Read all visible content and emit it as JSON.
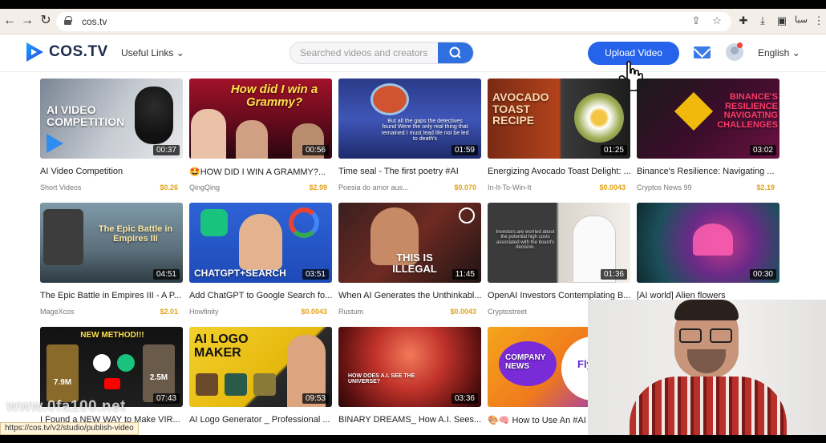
{
  "browser": {
    "url": "cos.tv",
    "extension_label": "ﺳﺒﺎ"
  },
  "header": {
    "logo_text": "COS.TV",
    "useful_links": "Useful Links",
    "search_placeholder": "Searched videos and creators",
    "upload_label": "Upload Video",
    "language": "English"
  },
  "videos": [
    {
      "title": "AI Video Competition",
      "author": "Short Videos",
      "price": "$0.26",
      "duration": "00:37",
      "thumb_text": "AI VIDEO COMPETITION"
    },
    {
      "title": "🤩HOW DID I WIN A GRAMMY?...",
      "author": "QingQing",
      "price": "$2.99",
      "duration": "00:56",
      "thumb_text": "How did I win a Grammy?"
    },
    {
      "title": "Time seal - The first poetry #AI",
      "author": "Poesia do amor aus...",
      "price": "$0.070",
      "duration": "01:59",
      "thumb_text": "But all the gaps the detectives found Were the only real thing that remained I must lead life not be led to death's"
    },
    {
      "title": "Energizing Avocado Toast Delight: ...",
      "author": "In-It-To-Win-It",
      "price": "$0.0043",
      "duration": "01:25",
      "thumb_text": "AVOCADO TOAST RECIPE"
    },
    {
      "title": "Binance's Resilience: Navigating ...",
      "author": "Cryptos News 99",
      "price": "$2.19",
      "duration": "03:02",
      "thumb_text": "BINANCE'S RESILIENCE NAVIGATING CHALLENGES"
    },
    {
      "title": "The Epic Battle in Empires III - A P...",
      "author": "MageXcos",
      "price": "$2.01",
      "duration": "04:51",
      "thumb_text": "The Epic Battle in Empires III"
    },
    {
      "title": "Add ChatGPT to Google Search fo...",
      "author": "Howfinity",
      "price": "$0.0043",
      "duration": "03:51",
      "thumb_text": "CHATGPT+SEARCH"
    },
    {
      "title": "When AI Generates the Unthinkabl...",
      "author": "Rustum",
      "price": "$0.0043",
      "duration": "11:45",
      "thumb_text": "THIS IS ILLEGAL"
    },
    {
      "title": "OpenAI Investors Contemplating B...",
      "author": "Cryptostreet",
      "price": "",
      "duration": "01:36",
      "thumb_text": "Investors are worried about the potential high costs associated with the board's decision."
    },
    {
      "title": "[AI world] Alien flowers",
      "author": "",
      "price": "",
      "duration": "00:30",
      "thumb_text": ""
    },
    {
      "title": "I Found a NEW WAY to Make VIR...",
      "author": "",
      "price": "",
      "duration": "07:43",
      "thumb_text": "NEW METHOD!!!"
    },
    {
      "title": "AI Logo Generator _ Professional ...",
      "author": "",
      "price": "",
      "duration": "09:53",
      "thumb_text": "AI LOGO MAKER"
    },
    {
      "title": "BINARY DREAMS_ How A.I. Sees...",
      "author": "",
      "price": "",
      "duration": "03:36",
      "thumb_text": "HOW DOES A.I. SEE THE UNIVERSE?"
    },
    {
      "title": "🎨🧠 How to Use An #AI",
      "author": "",
      "price": "",
      "duration": "",
      "thumb_text": "COMPANY NEWS"
    }
  ],
  "thumb_extra": {
    "new_method_a": "7.9M",
    "new_method_b": "2.5M",
    "company_right": "FlyF"
  },
  "status_url": "https://cos.tv/v2/studio/publish-video",
  "watermark": "www.0fa100.net"
}
